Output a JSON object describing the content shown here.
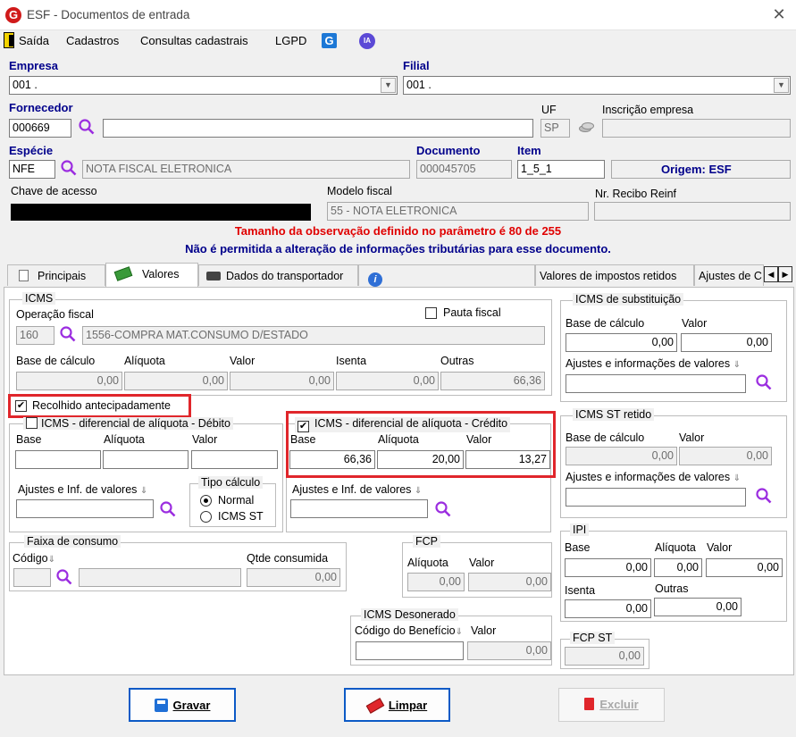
{
  "window": {
    "title": "ESF - Documentos de entrada",
    "logo_letter": "G"
  },
  "menu": {
    "items": [
      "Saída",
      "Cadastros",
      "Consultas cadastrais",
      "LGPD"
    ],
    "ia_label": "IA"
  },
  "header": {
    "empresa_label": "Empresa",
    "empresa_value": "001 .",
    "filial_label": "Filial",
    "filial_value": "001 .",
    "fornecedor_label": "Fornecedor",
    "fornecedor_code": "000669",
    "fornecedor_name": "",
    "uf_label": "UF",
    "uf_value": "SP",
    "inscricao_label": "Inscrição empresa",
    "inscricao_value": "",
    "especie_label": "Espécie",
    "especie_code": "NFE",
    "especie_name": "NOTA FISCAL ELETRONICA",
    "documento_label": "Documento",
    "documento_value": "000045705",
    "item_label": "Item",
    "item_value": "1_5_1",
    "origem_label": "Origem: ESF",
    "chave_label": "Chave de acesso",
    "modelo_label": "Modelo fiscal",
    "modelo_value": "55 - NOTA ELETRONICA",
    "recibo_label": "Nr. Recibo Reinf",
    "recibo_value": ""
  },
  "messages": {
    "warning": "Tamanho da observação definido no parâmetro é 80 de 255",
    "info": "Não é permitida a alteração de informações tributárias para esse documento."
  },
  "tabs": [
    "Principais",
    "Valores",
    "Dados do transportador",
    "Valores de impostos retidos",
    "Ajustes de C"
  ],
  "icms": {
    "title": "ICMS",
    "operacao_label": "Operação fiscal",
    "operacao_code": "160",
    "operacao_desc": "1556-COMPRA MAT.CONSUMO D/ESTADO",
    "pauta_label": "Pauta fiscal",
    "base_label": "Base de cálculo",
    "base_value": "0,00",
    "aliquota_label": "Alíquota",
    "aliquota_value": "0,00",
    "valor_label": "Valor",
    "valor_value": "0,00",
    "isenta_label": "Isenta",
    "isenta_value": "0,00",
    "outras_label": "Outras",
    "outras_value": "66,36"
  },
  "recolhido_label": "Recolhido antecipadamente",
  "difal_debito": {
    "title": "ICMS - diferencial de alíquota - Débito",
    "base_label": "Base",
    "aliquota_label": "Alíquota",
    "valor_label": "Valor",
    "base_value": "",
    "aliquota_value": "",
    "valor_value": "",
    "ajustes_label": "Ajustes e Inf. de valores",
    "tipo_title": "Tipo cálculo",
    "tipo_normal": "Normal",
    "tipo_icmsst": "ICMS ST"
  },
  "difal_credito": {
    "title": "ICMS - diferencial de alíquota - Crédito",
    "base_label": "Base",
    "aliquota_label": "Alíquota",
    "valor_label": "Valor",
    "base_value": "66,36",
    "aliquota_value": "20,00",
    "valor_value": "13,27",
    "ajustes_label": "Ajustes e Inf. de valores"
  },
  "faixa": {
    "title": "Faixa de consumo",
    "codigo_label": "Código",
    "qtde_label": "Qtde consumida",
    "qtde_value": "0,00"
  },
  "fcp": {
    "title": "FCP",
    "aliquota_label": "Alíquota",
    "valor_label": "Valor",
    "aliquota_value": "0,00",
    "valor_value": "0,00"
  },
  "desonerado": {
    "title": "ICMS Desonerado",
    "codigo_label": "Código do Benefício",
    "valor_label": "Valor",
    "valor_value": "0,00"
  },
  "icms_sub": {
    "title": "ICMS de substituição",
    "base_label": "Base de cálculo",
    "valor_label": "Valor",
    "base_value": "0,00",
    "valor_value": "0,00",
    "ajustes_label": "Ajustes e informações de valores"
  },
  "icms_st": {
    "title": "ICMS ST retido",
    "base_label": "Base de cálculo",
    "valor_label": "Valor",
    "base_value": "0,00",
    "valor_value": "0,00",
    "ajustes_label": "Ajustes e informações de valores"
  },
  "ipi": {
    "title": "IPI",
    "base_label": "Base",
    "aliquota_label": "Alíquota",
    "valor_label": "Valor",
    "base_value": "0,00",
    "aliquota_value": "0,00",
    "valor_value": "0,00",
    "isenta_label": "Isenta",
    "isenta_value": "0,00",
    "outras_label": "Outras",
    "outras_value": "0,00"
  },
  "fcp_st": {
    "title": "FCP ST",
    "value": "0,00"
  },
  "buttons": {
    "gravar": "Gravar",
    "limpar": "Limpar",
    "excluir": "Excluir"
  }
}
